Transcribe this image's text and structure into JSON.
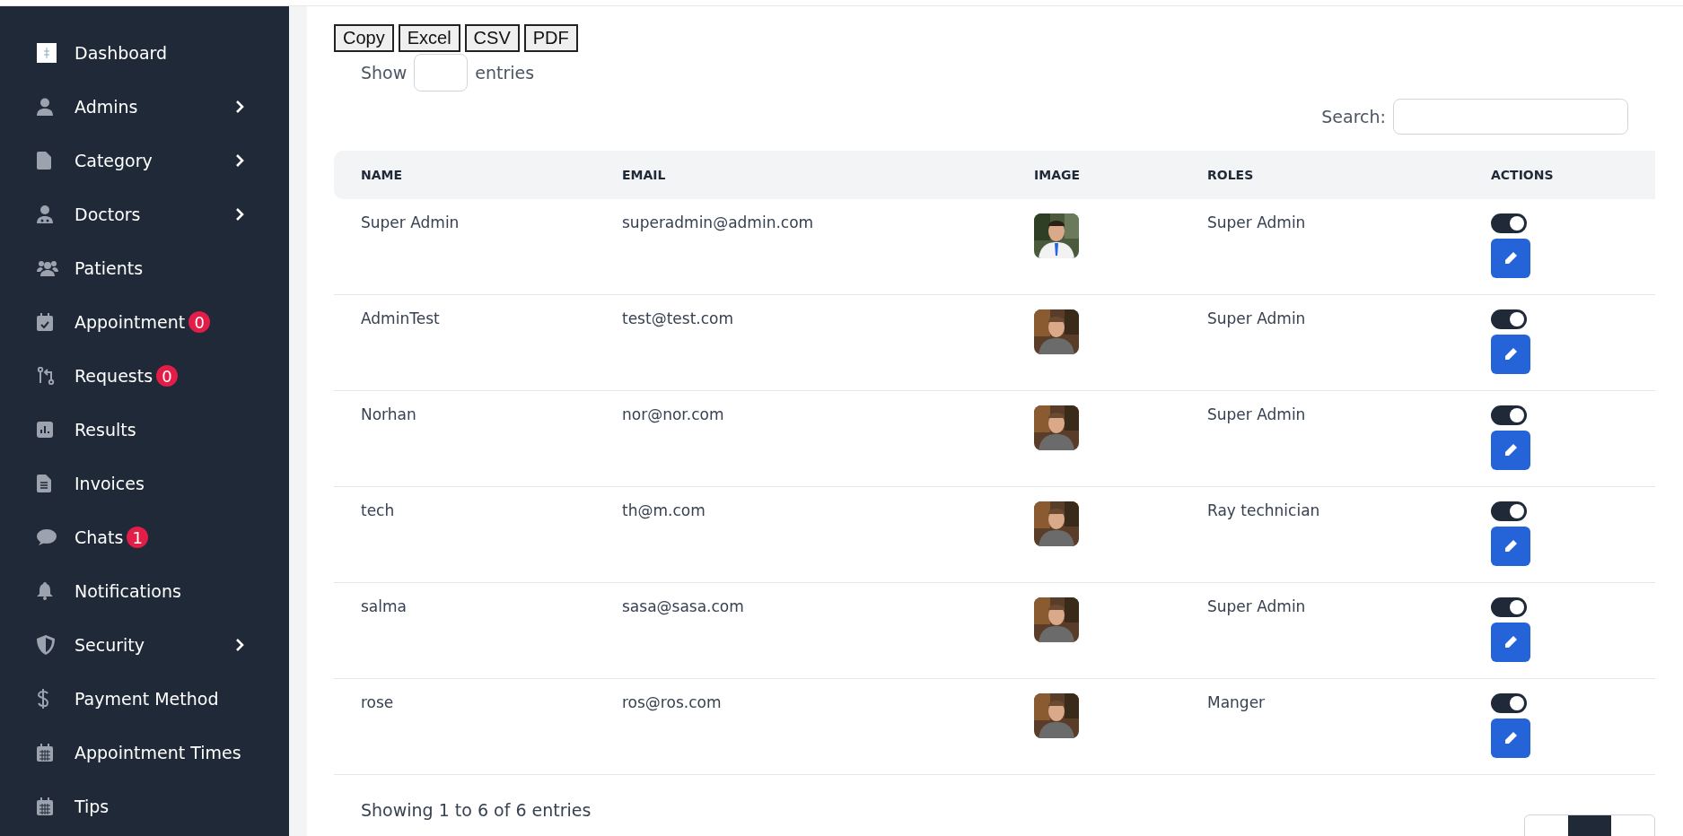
{
  "sidebar": {
    "items": [
      {
        "label": "Dashboard",
        "submenu": false
      },
      {
        "label": "Admins",
        "submenu": true
      },
      {
        "label": "Category",
        "submenu": true
      },
      {
        "label": "Doctors",
        "submenu": true
      },
      {
        "label": "Patients",
        "submenu": false
      },
      {
        "label": "Appointment",
        "submenu": false,
        "badge": "0"
      },
      {
        "label": "Requests",
        "submenu": false,
        "badge": "0"
      },
      {
        "label": "Results",
        "submenu": false
      },
      {
        "label": "Invoices",
        "submenu": false
      },
      {
        "label": "Chats",
        "submenu": false,
        "badge": "1"
      },
      {
        "label": "Notifications",
        "submenu": false
      },
      {
        "label": "Security",
        "submenu": true
      },
      {
        "label": "Payment Method",
        "submenu": false
      },
      {
        "label": "Appointment Times",
        "submenu": false
      },
      {
        "label": "Tips",
        "submenu": false
      }
    ]
  },
  "export_buttons": [
    "Copy",
    "Excel",
    "CSV",
    "PDF"
  ],
  "length": {
    "before": "Show",
    "after": "entries"
  },
  "search": {
    "label": "Search:"
  },
  "table": {
    "columns": [
      "NAME",
      "EMAIL",
      "IMAGE",
      "ROLES",
      "ACTIONS"
    ],
    "rows": [
      {
        "name": "Super Admin",
        "email": "superadmin@admin.com",
        "role": "Super Admin",
        "on": true
      },
      {
        "name": "AdminTest",
        "email": "test@test.com",
        "role": "Super Admin",
        "on": true
      },
      {
        "name": "Norhan",
        "email": "nor@nor.com",
        "role": "Super Admin",
        "on": true
      },
      {
        "name": "tech",
        "email": "th@m.com",
        "role": "Ray technician",
        "on": true
      },
      {
        "name": "salma",
        "email": "sasa@sasa.com",
        "role": "Super Admin",
        "on": true
      },
      {
        "name": "rose",
        "email": "ros@ros.com",
        "role": "Manger",
        "on": true
      }
    ]
  },
  "info": "Showing 1 to 6 of 6 entries"
}
